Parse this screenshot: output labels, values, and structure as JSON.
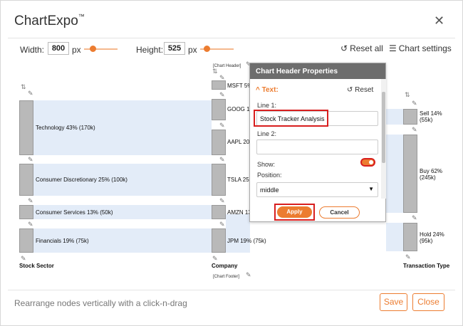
{
  "dialog": {
    "title": "ChartExpo",
    "trademark": "™",
    "close_icon": "close-icon"
  },
  "toolbar": {
    "width_label": "Width:",
    "width_value": "800",
    "width_unit": "px",
    "height_label": "Height:",
    "height_value": "525",
    "height_unit": "px",
    "reset_all": "Reset all",
    "chart_settings": "Chart settings"
  },
  "chart": {
    "header_tag": "[Chart Header]",
    "footer_tag": "[Chart Footer]",
    "axis_labels": [
      "Stock Sector",
      "Company",
      "Transaction Type"
    ],
    "sectors": [
      {
        "label": "Technology 43% (170k)"
      },
      {
        "label": "Consumer Discretionary 25% (100k)"
      },
      {
        "label": "Consumer Services 13% (50k)"
      },
      {
        "label": "Financials 19% (75k)"
      }
    ],
    "companies": [
      {
        "label": "MSFT 5%"
      },
      {
        "label": "GOOG 1"
      },
      {
        "label": "AAPL 20"
      },
      {
        "label": "TSLA 25"
      },
      {
        "label": "AMZN 13"
      },
      {
        "label": "JPM 19% (75k)"
      }
    ],
    "transactions": [
      {
        "line1": "Sell 14%",
        "line2": "(55k)"
      },
      {
        "line1": "Buy 62%",
        "line2": "(245k)"
      },
      {
        "line1": "Hold 24%",
        "line2": "(95k)"
      }
    ]
  },
  "panel": {
    "title": "Chart Header Properties",
    "section": "Text:",
    "reset": "Reset",
    "line1_label": "Line 1:",
    "line1_value": "Stock Tracker Analysis",
    "line2_label": "Line 2:",
    "line2_value": "",
    "show_label": "Show:",
    "show_on": true,
    "position_label": "Position:",
    "position_value": "middle",
    "apply": "Apply",
    "cancel": "Cancel"
  },
  "footer": {
    "hint": "Rearrange nodes vertically with a click-n-drag",
    "save": "Save",
    "close": "Close"
  },
  "colors": {
    "accent": "#ec7c30",
    "highlight": "#d81e1e",
    "flow": "#e3ecf8",
    "node": "#b9b9b9"
  }
}
